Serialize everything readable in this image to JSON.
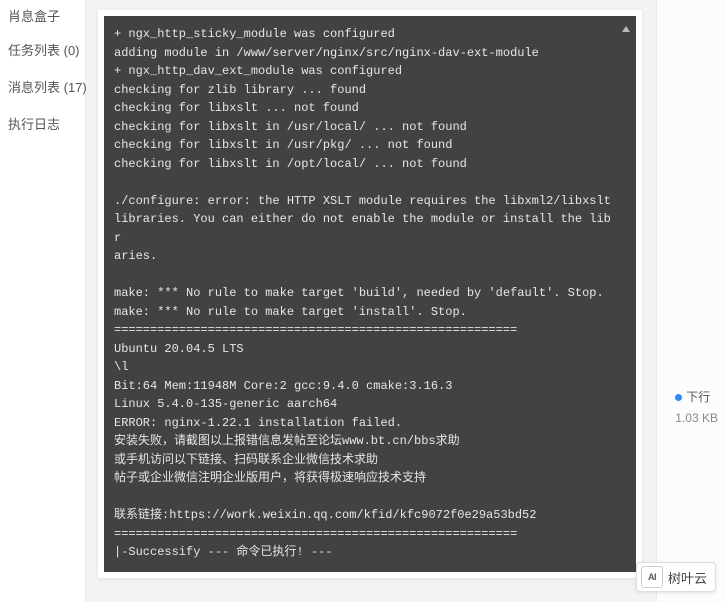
{
  "sidebar": {
    "header": "肖息盒子",
    "items": [
      {
        "label": "任务列表 (0)"
      },
      {
        "label": "消息列表 (17)"
      },
      {
        "label": "执行日志"
      }
    ]
  },
  "console": {
    "lines": [
      "+ ngx_http_sticky_module was configured",
      "adding module in /www/server/nginx/src/nginx-dav-ext-module",
      "+ ngx_http_dav_ext_module was configured",
      "checking for zlib library ... found",
      "checking for libxslt ... not found",
      "checking for libxslt in /usr/local/ ... not found",
      "checking for libxslt in /usr/pkg/ ... not found",
      "checking for libxslt in /opt/local/ ... not found",
      "",
      "./configure: error: the HTTP XSLT module requires the libxml2/libxslt",
      "libraries. You can either do not enable the module or install the libr",
      "aries.",
      "",
      "make: *** No rule to make target 'build', needed by 'default'. Stop.",
      "make: *** No rule to make target 'install'. Stop.",
      "========================================================",
      "Ubuntu 20.04.5 LTS",
      "\\l",
      "Bit:64 Mem:11948M Core:2 gcc:9.4.0 cmake:3.16.3",
      "Linux 5.4.0-135-generic aarch64",
      "ERROR: nginx-1.22.1 installation failed.",
      "安装失败，请截图以上报错信息发帖至论坛www.bt.cn/bbs求助",
      "或手机访问以下链接、扫码联系企业微信技术求助",
      "帖子或企业微信注明企业版用户，将获得极速响应技术支持",
      "",
      "联系链接:https://work.weixin.qq.com/kfid/kfc9072f0e29a53bd52",
      "========================================================",
      "|-Successify --- 命令已执行! ---"
    ]
  },
  "status": {
    "label": "下行",
    "value": "1.03 KB"
  },
  "brand": {
    "logo": "AI",
    "name": "树叶云"
  }
}
